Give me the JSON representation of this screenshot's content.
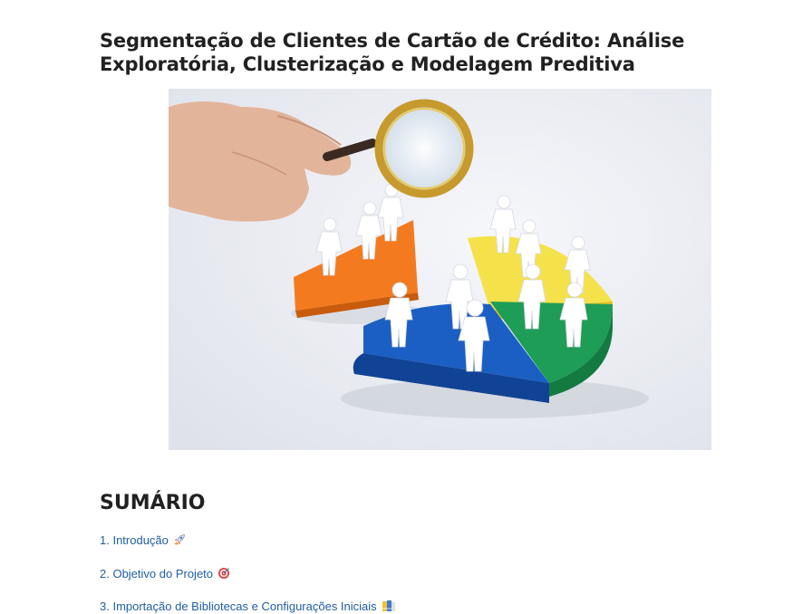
{
  "document": {
    "title": "Segmentação de Clientes de Cartão de Crédito: Análise Exploratória, Clusterização e Modelagem Preditiva"
  },
  "hero_image": {
    "alt": "",
    "icon": "magnifier-pie-chart-people-illustration"
  },
  "summary": {
    "heading": "SUMÁRIO",
    "items": [
      {
        "label": "1. Introdução",
        "icon": "rocket-icon"
      },
      {
        "label": "2. Objetivo do Projeto",
        "icon": "target-icon"
      },
      {
        "label": "3. Importação de Bibliotecas e Configurações Iniciais",
        "icon": "books-icon"
      }
    ]
  },
  "colors": {
    "link": "#1f5fa0",
    "heading": "#212121",
    "pie_orange": "#f47a20",
    "pie_yellow": "#f5e24a",
    "pie_green": "#1e9d57",
    "pie_blue": "#1b5fc4"
  }
}
